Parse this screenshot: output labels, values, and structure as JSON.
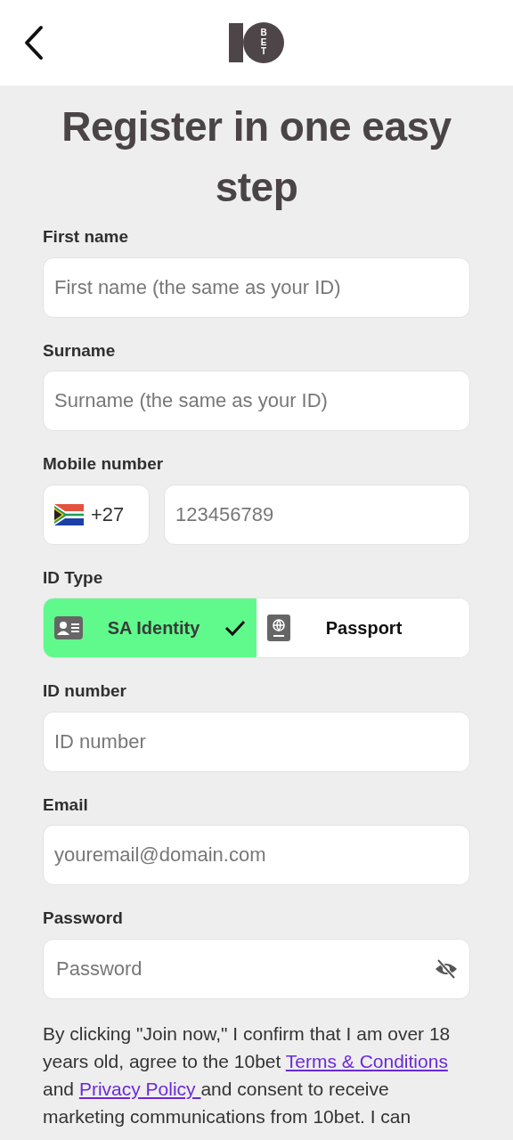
{
  "header": {
    "logo_text": "BET"
  },
  "title": "Register in one easy step",
  "fields": [
    {
      "kind": "text",
      "label": "First name",
      "placeholder": "First name (the same as your ID)"
    },
    {
      "kind": "text",
      "label": "Surname",
      "placeholder": "Surname (the same as your ID)"
    },
    {
      "kind": "phone",
      "label": "Mobile number",
      "code": "+27",
      "placeholder": "123456789"
    },
    {
      "kind": "idtype",
      "label": "ID Type",
      "options": [
        {
          "label": "SA Identity",
          "selected": true
        },
        {
          "label": "Passport",
          "selected": false
        }
      ]
    },
    {
      "kind": "text",
      "label": "ID number",
      "placeholder": "ID number"
    },
    {
      "kind": "text",
      "label": "Email",
      "placeholder": "youremail@domain.com"
    },
    {
      "kind": "password",
      "label": "Password",
      "placeholder": "Password"
    }
  ],
  "consent": {
    "before": "By clicking \"Join now,\" I confirm that I am over 18 years old, agree to the 10bet ",
    "link1": "Terms & Conditions",
    "middle": " and ",
    "link2": "Privacy Policy ",
    "after": "and consent to receive marketing communications from 10bet. I can"
  }
}
